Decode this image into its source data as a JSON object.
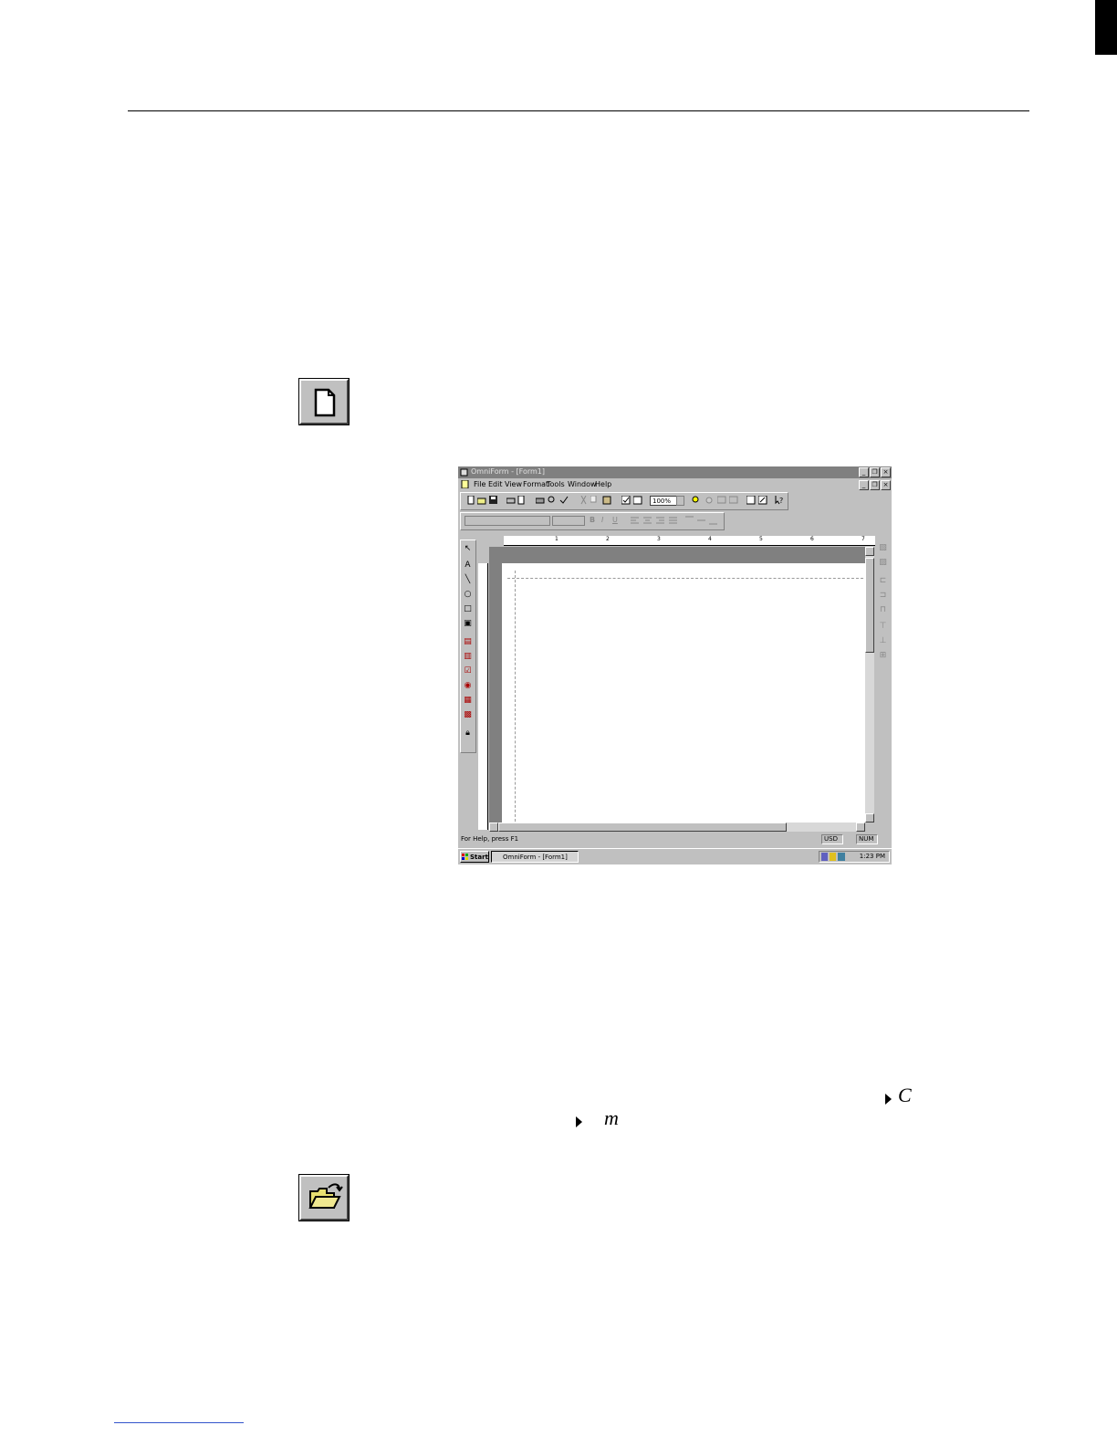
{
  "app": {
    "title": "OmniForm - [Form1]",
    "menu": [
      "File",
      "Edit",
      "View",
      "Format",
      "Tools",
      "Window",
      "Help"
    ],
    "zoom": "100%",
    "status_text": "For Help, press F1",
    "status_panels": [
      "USD",
      "NUM"
    ],
    "start_label": "Start",
    "task_item": "OmniForm - [Form1]",
    "clock": "1:23 PM",
    "ruler_numbers": [
      "1",
      "2",
      "3",
      "4",
      "5",
      "6",
      "7"
    ]
  },
  "fragments": {
    "c": "C",
    "m": "m"
  },
  "icons": {
    "new_button": "new-document-icon",
    "open_button": "open-folder-icon"
  },
  "colors": {
    "button_face": "#c0c0c0",
    "folder": "#e8e070"
  }
}
